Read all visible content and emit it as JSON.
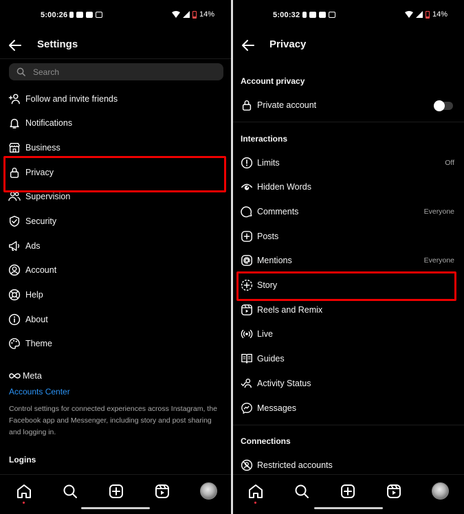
{
  "left_screen": {
    "status": {
      "time": "5:00:26",
      "battery": "14%"
    },
    "header": {
      "title": "Settings"
    },
    "search": {
      "placeholder": "Search"
    },
    "items": [
      {
        "label": "Follow and invite friends",
        "icon": "add-person-icon"
      },
      {
        "label": "Notifications",
        "icon": "bell-icon"
      },
      {
        "label": "Business",
        "icon": "shop-icon"
      },
      {
        "label": "Privacy",
        "icon": "lock-icon"
      },
      {
        "label": "Supervision",
        "icon": "people-icon"
      },
      {
        "label": "Security",
        "icon": "shield-icon"
      },
      {
        "label": "Ads",
        "icon": "megaphone-icon"
      },
      {
        "label": "Account",
        "icon": "user-circle-icon"
      },
      {
        "label": "Help",
        "icon": "lifebuoy-icon"
      },
      {
        "label": "About",
        "icon": "info-icon"
      },
      {
        "label": "Theme",
        "icon": "palette-icon"
      }
    ],
    "meta_logo": "Meta",
    "accounts_center": "Accounts Center",
    "accounts_center_desc": "Control settings for connected experiences across Instagram, the Facebook app and Messenger, including story and post sharing and logging in.",
    "logins_heading": "Logins",
    "highlighted_item": "Privacy"
  },
  "right_screen": {
    "status": {
      "time": "5:00:32",
      "battery": "14%"
    },
    "header": {
      "title": "Privacy"
    },
    "account_privacy": {
      "heading": "Account privacy",
      "private_account": {
        "label": "Private account",
        "icon": "lock-icon",
        "enabled": false
      }
    },
    "interactions": {
      "heading": "Interactions",
      "items": [
        {
          "label": "Limits",
          "value": "Off",
          "icon": "alert-circle-icon"
        },
        {
          "label": "Hidden Words",
          "value": "",
          "icon": "eye-icon"
        },
        {
          "label": "Comments",
          "value": "Everyone",
          "icon": "comment-icon"
        },
        {
          "label": "Posts",
          "value": "",
          "icon": "plus-square-icon"
        },
        {
          "label": "Mentions",
          "value": "Everyone",
          "icon": "at-icon"
        },
        {
          "label": "Story",
          "value": "",
          "icon": "story-add-icon"
        },
        {
          "label": "Reels and Remix",
          "value": "",
          "icon": "reels-icon"
        },
        {
          "label": "Live",
          "value": "",
          "icon": "live-icon"
        },
        {
          "label": "Guides",
          "value": "",
          "icon": "guides-icon"
        },
        {
          "label": "Activity Status",
          "value": "",
          "icon": "activity-status-icon"
        },
        {
          "label": "Messages",
          "value": "",
          "icon": "messenger-icon"
        }
      ]
    },
    "connections": {
      "heading": "Connections",
      "items": [
        {
          "label": "Restricted accounts",
          "icon": "restricted-icon"
        }
      ]
    },
    "highlighted_item": "Story"
  },
  "bottom_nav": [
    "home-icon",
    "search-icon",
    "create-icon",
    "reels-icon",
    "profile-avatar"
  ],
  "colors": {
    "background": "#000000",
    "highlight": "#e00000",
    "link": "#2b93f5",
    "muted": "#a8a8a8"
  }
}
